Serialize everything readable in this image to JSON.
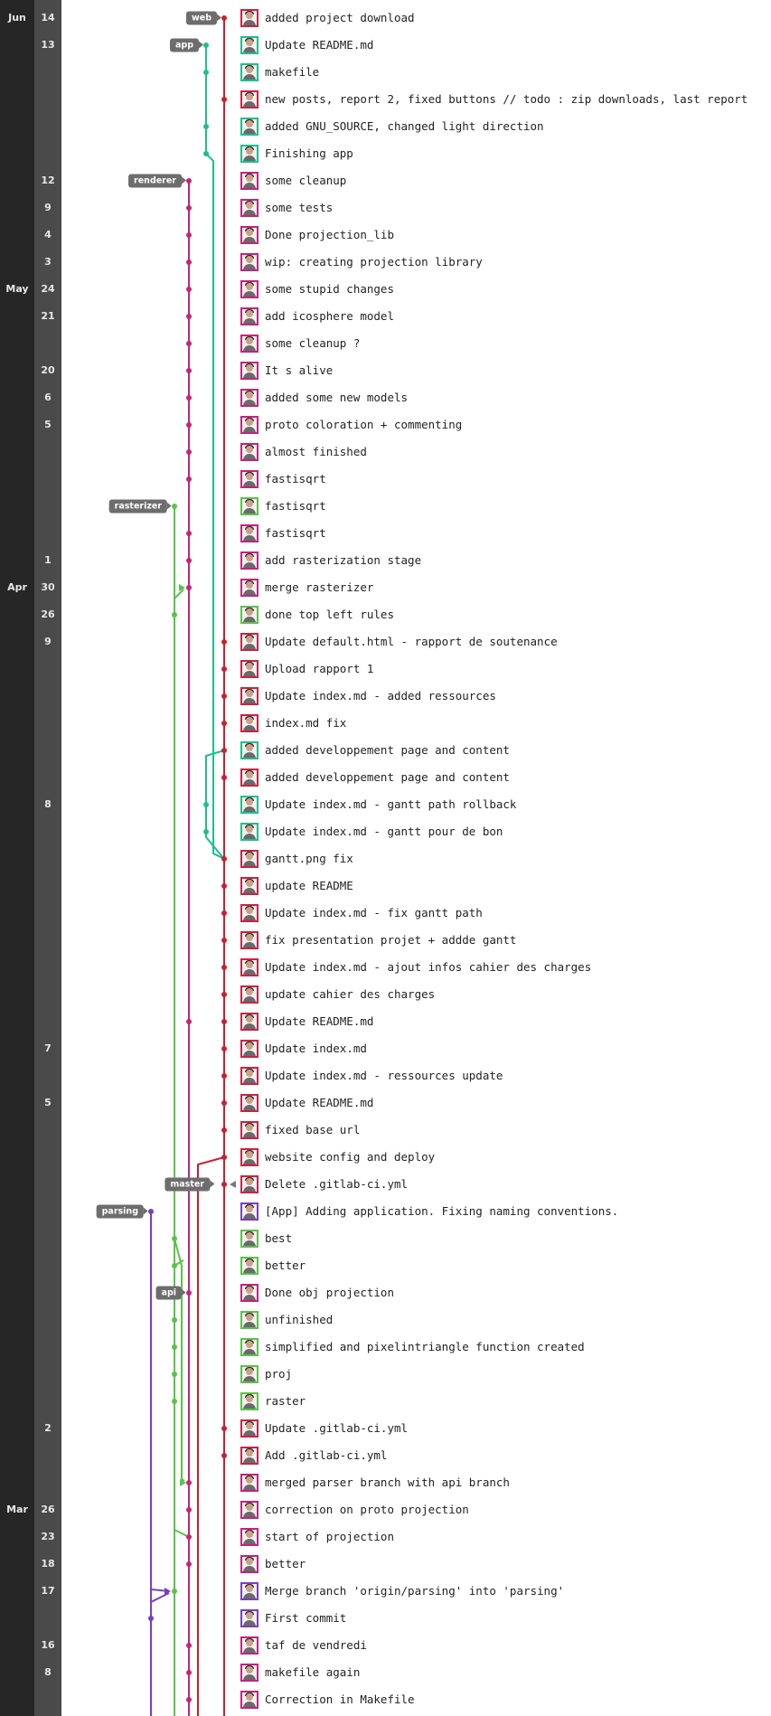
{
  "months": [
    {
      "label": "Jun",
      "row": 0
    },
    {
      "label": "May",
      "row": 10
    },
    {
      "label": "Apr",
      "row": 21
    },
    {
      "label": "Mar",
      "row": 55
    }
  ],
  "days": [
    {
      "label": "14",
      "row": 0
    },
    {
      "label": "13",
      "row": 1
    },
    {
      "label": "12",
      "row": 6
    },
    {
      "label": "9",
      "row": 7
    },
    {
      "label": "4",
      "row": 8
    },
    {
      "label": "3",
      "row": 9
    },
    {
      "label": "24",
      "row": 10
    },
    {
      "label": "21",
      "row": 11
    },
    {
      "label": "20",
      "row": 13
    },
    {
      "label": "6",
      "row": 14
    },
    {
      "label": "5",
      "row": 15
    },
    {
      "label": "1",
      "row": 20
    },
    {
      "label": "30",
      "row": 21
    },
    {
      "label": "26",
      "row": 22
    },
    {
      "label": "9",
      "row": 23
    },
    {
      "label": "8",
      "row": 29
    },
    {
      "label": "7",
      "row": 38
    },
    {
      "label": "5",
      "row": 40
    },
    {
      "label": "2",
      "row": 52
    },
    {
      "label": "26",
      "row": 55
    },
    {
      "label": "23",
      "row": 56
    },
    {
      "label": "18",
      "row": 57
    },
    {
      "label": "17",
      "row": 58
    },
    {
      "label": "16",
      "row": 60
    },
    {
      "label": "8",
      "row": 61
    }
  ],
  "refs": [
    {
      "label": "web",
      "row": 0,
      "color": "#cc1f2e"
    },
    {
      "label": "app",
      "row": 1,
      "color": "#1cbf8c"
    },
    {
      "label": "renderer",
      "row": 6,
      "color": "#c4237e"
    },
    {
      "label": "rasterizer",
      "row": 18,
      "color": "#5ac24a"
    },
    {
      "label": "master",
      "row": 43,
      "color": "#cc1f2e"
    },
    {
      "label": "parsing",
      "row": 44,
      "color": "#7a3ec0"
    },
    {
      "label": "api",
      "row": 47,
      "color": "#c4237e"
    }
  ],
  "commits": [
    {
      "message": "added project download",
      "avatar_color": "#cc2244"
    },
    {
      "message": "Update README.md",
      "avatar_color": "#1cbf8c"
    },
    {
      "message": "makefile",
      "avatar_color": "#1cbf8c"
    },
    {
      "message": "new posts, report 2, fixed buttons // todo : zip downloads, last report",
      "avatar_color": "#cc2244"
    },
    {
      "message": "added GNU_SOURCE, changed light direction",
      "avatar_color": "#1cbf8c"
    },
    {
      "message": "Finishing app",
      "avatar_color": "#1cbf8c"
    },
    {
      "message": "some cleanup",
      "avatar_color": "#c4237e"
    },
    {
      "message": "some tests",
      "avatar_color": "#c4237e"
    },
    {
      "message": "Done projection_lib",
      "avatar_color": "#c4237e"
    },
    {
      "message": "wip: creating projection library",
      "avatar_color": "#c4237e"
    },
    {
      "message": "some stupid changes",
      "avatar_color": "#c4237e"
    },
    {
      "message": "add icosphere model",
      "avatar_color": "#c4237e"
    },
    {
      "message": "some cleanup ?",
      "avatar_color": "#c4237e"
    },
    {
      "message": "It s alive",
      "avatar_color": "#c4237e"
    },
    {
      "message": "added some new models",
      "avatar_color": "#c4237e"
    },
    {
      "message": "proto coloration + commenting",
      "avatar_color": "#c4237e"
    },
    {
      "message": "almost finished",
      "avatar_color": "#c4237e"
    },
    {
      "message": "fastisqrt",
      "avatar_color": "#c4237e"
    },
    {
      "message": "fastisqrt",
      "avatar_color": "#5ac24a"
    },
    {
      "message": "fastisqrt",
      "avatar_color": "#c4237e"
    },
    {
      "message": "add rasterization stage",
      "avatar_color": "#c4237e"
    },
    {
      "message": "merge rasterizer",
      "avatar_color": "#c4237e"
    },
    {
      "message": "done top left rules",
      "avatar_color": "#5ac24a"
    },
    {
      "message": "Update default.html - rapport de soutenance",
      "avatar_color": "#cc2244"
    },
    {
      "message": "Upload rapport 1",
      "avatar_color": "#cc2244"
    },
    {
      "message": "Update index.md - added ressources",
      "avatar_color": "#cc2244"
    },
    {
      "message": "index.md fix",
      "avatar_color": "#cc2244"
    },
    {
      "message": "added developpement page and content",
      "avatar_color": "#1cbf8c"
    },
    {
      "message": "added developpement page and content",
      "avatar_color": "#cc2244"
    },
    {
      "message": "Update index.md - gantt path rollback",
      "avatar_color": "#1cbf8c"
    },
    {
      "message": "Update index.md - gantt pour de bon",
      "avatar_color": "#1cbf8c"
    },
    {
      "message": "gantt.png fix",
      "avatar_color": "#cc2244"
    },
    {
      "message": "update README",
      "avatar_color": "#cc2244"
    },
    {
      "message": "Update index.md - fix gantt path",
      "avatar_color": "#cc2244"
    },
    {
      "message": "fix presentation projet + addde gantt",
      "avatar_color": "#cc2244"
    },
    {
      "message": "Update index.md - ajout infos cahier des charges",
      "avatar_color": "#cc2244"
    },
    {
      "message": "update cahier des charges",
      "avatar_color": "#cc2244"
    },
    {
      "message": "Update README.md",
      "avatar_color": "#cc2244"
    },
    {
      "message": "Update index.md",
      "avatar_color": "#cc2244"
    },
    {
      "message": "Update index.md - ressources update",
      "avatar_color": "#cc2244"
    },
    {
      "message": "Update README.md",
      "avatar_color": "#cc2244"
    },
    {
      "message": "fixed base url",
      "avatar_color": "#cc2244"
    },
    {
      "message": "website config and deploy",
      "avatar_color": "#cc2244"
    },
    {
      "message": "Delete .gitlab-ci.yml",
      "avatar_color": "#cc2244"
    },
    {
      "message": "[App] Adding application. Fixing naming conventions.",
      "avatar_color": "#7a3ec0"
    },
    {
      "message": "best",
      "avatar_color": "#5ac24a"
    },
    {
      "message": "better",
      "avatar_color": "#5ac24a"
    },
    {
      "message": "Done obj projection",
      "avatar_color": "#c4237e"
    },
    {
      "message": "unfinished",
      "avatar_color": "#5ac24a"
    },
    {
      "message": "simplified and pixelintriangle function created",
      "avatar_color": "#5ac24a"
    },
    {
      "message": "proj",
      "avatar_color": "#5ac24a"
    },
    {
      "message": "raster",
      "avatar_color": "#5ac24a"
    },
    {
      "message": "Update .gitlab-ci.yml",
      "avatar_color": "#cc2244"
    },
    {
      "message": "Add .gitlab-ci.yml",
      "avatar_color": "#cc2244"
    },
    {
      "message": "merged parser branch with api branch",
      "avatar_color": "#c4237e"
    },
    {
      "message": "correction on proto projection",
      "avatar_color": "#c4237e"
    },
    {
      "message": "start of projection",
      "avatar_color": "#c4237e"
    },
    {
      "message": "better",
      "avatar_color": "#c4237e"
    },
    {
      "message": "Merge branch 'origin/parsing' into 'parsing'",
      "avatar_color": "#7a3ec0"
    },
    {
      "message": "First commit",
      "avatar_color": "#7a3ec0"
    },
    {
      "message": "taf de vendredi",
      "avatar_color": "#c4237e"
    },
    {
      "message": "makefile again",
      "avatar_color": "#c4237e"
    },
    {
      "message": "Correction in Makefile",
      "avatar_color": "#c4237e"
    }
  ]
}
